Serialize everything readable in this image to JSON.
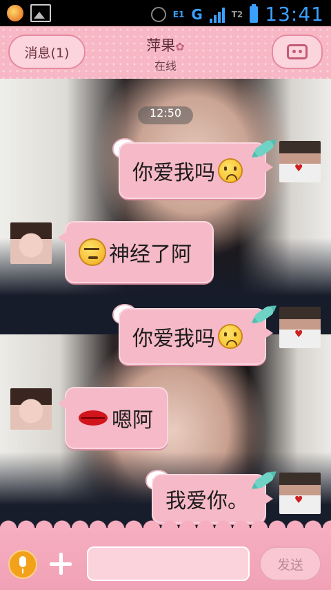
{
  "status_bar": {
    "network_label": "E1",
    "network_g": "G",
    "sim2_label": "T2",
    "time": "13:41",
    "icons": [
      "app-notification-icon",
      "image-icon",
      "alarm-icon",
      "signal-icon",
      "battery-icon"
    ]
  },
  "header": {
    "back_label": "消息(1)",
    "contact_name": "萍果",
    "contact_flower": "✿",
    "contact_status": "在线",
    "menu_icon": "profile-menu-icon"
  },
  "chat": {
    "timestamp": "12:50",
    "messages": [
      {
        "from": "me",
        "text": "你爱我吗",
        "emoji": "sad-face"
      },
      {
        "from": "her",
        "text": "神经了阿",
        "emoji": "smug-face"
      },
      {
        "from": "me",
        "text": "你爱我吗",
        "emoji": "sad-face"
      },
      {
        "from": "her",
        "text": "嗯阿",
        "emoji": "lips"
      },
      {
        "from": "me",
        "text": "我爱你。",
        "emoji": ""
      }
    ]
  },
  "composer": {
    "input_value": "",
    "send_label": "发送",
    "icons": [
      "microphone-icon",
      "plus-icon"
    ]
  },
  "colors": {
    "accent_pink": "#f6b9c8",
    "header_pink": "#f7b7c4",
    "status_blue": "#3aa0ff"
  }
}
